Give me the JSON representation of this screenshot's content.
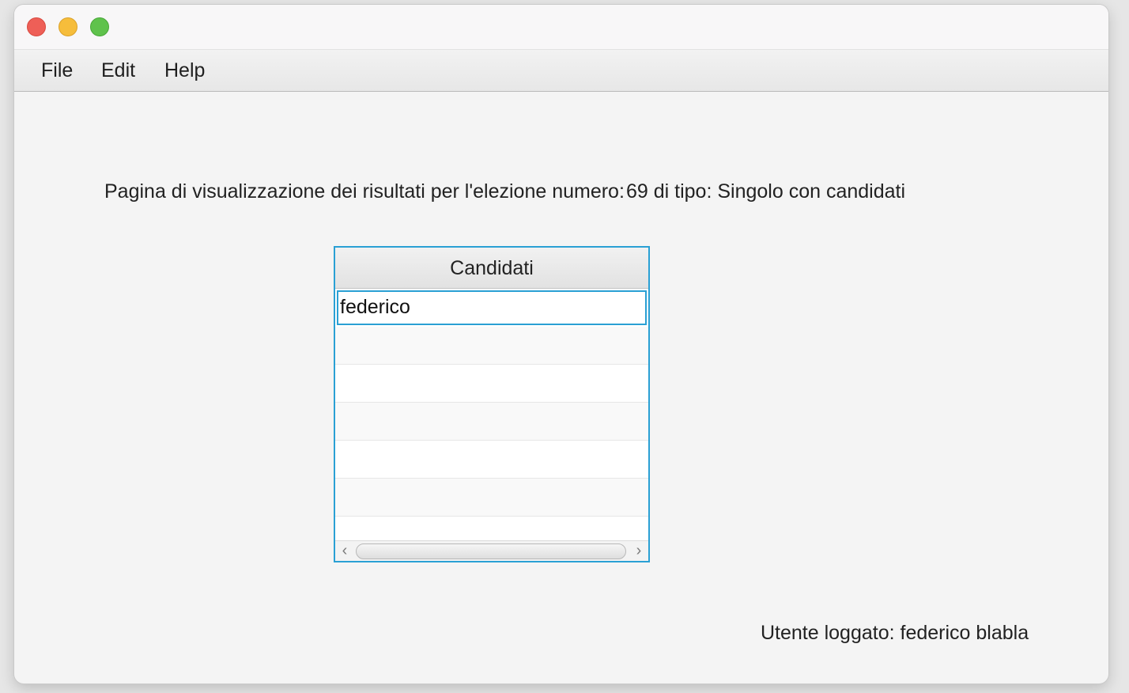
{
  "menu": {
    "file": "File",
    "edit": "Edit",
    "help": "Help"
  },
  "heading": {
    "label": "Pagina di visualizzazione dei risultati per l'elezione numero:",
    "value": "69 di tipo: Singolo con candidati"
  },
  "table": {
    "column_header": "Candidati",
    "rows": [
      "federico",
      "",
      "",
      "",
      "",
      "",
      ""
    ]
  },
  "scrollbar": {
    "left_arrow": "‹",
    "right_arrow": "›"
  },
  "status": {
    "logged_user": "Utente loggato: federico blabla"
  },
  "colors": {
    "accent": "#2aa0d4",
    "close": "#ee5f57",
    "minimize": "#f6bd3b",
    "maximize": "#5fc24c"
  }
}
